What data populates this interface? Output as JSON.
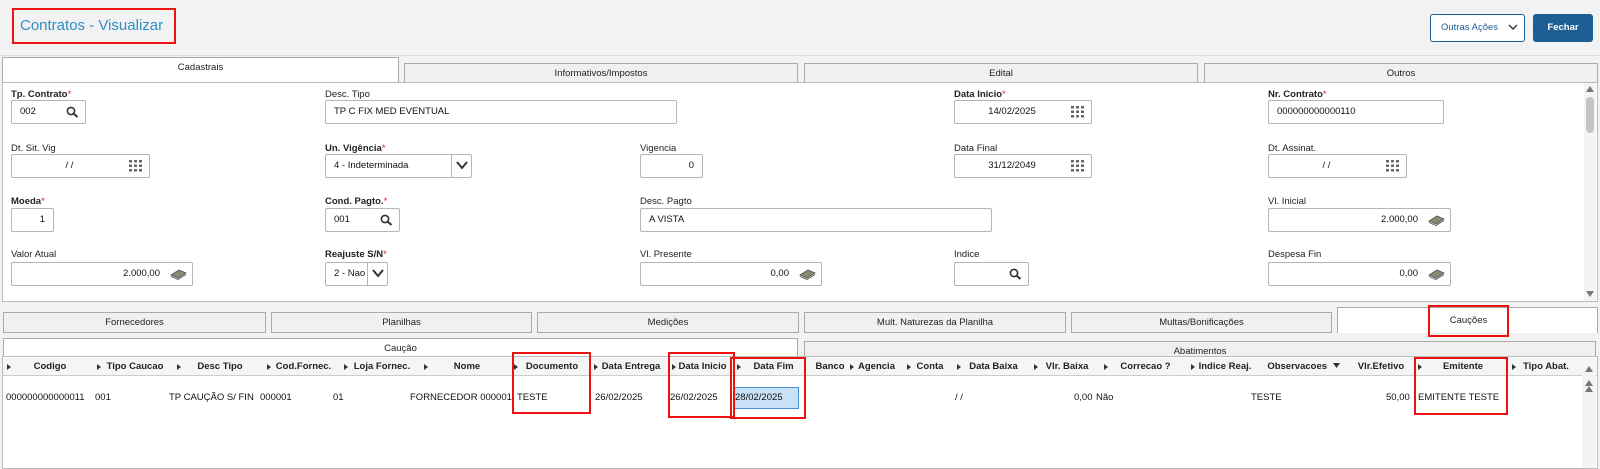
{
  "header": {
    "title": "Contratos - Visualizar",
    "actions_label": "Outras Ações",
    "close_label": "Fechar"
  },
  "top_tabs": [
    "Cadastrais",
    "Informativos/Impostos",
    "Edital",
    "Outros"
  ],
  "form": {
    "tp_contrato": {
      "label": "Tp. Contrato",
      "value": "002"
    },
    "desc_tipo": {
      "label": "Desc. Tipo",
      "value": "TP C FIX MED EVENTUAL"
    },
    "data_inicio": {
      "label": "Data Inicio",
      "value": "14/02/2025"
    },
    "nr_contrato": {
      "label": "Nr. Contrato",
      "value": "000000000000110"
    },
    "dt_sit_vig": {
      "label": "Dt. Sit. Vig",
      "value": " /  /"
    },
    "un_vigencia": {
      "label": "Un. Vigência",
      "value": "4 - Indeterminada"
    },
    "vigencia": {
      "label": "Vigencia",
      "value": "0"
    },
    "data_final": {
      "label": "Data Final",
      "value": "31/12/2049"
    },
    "dt_assinat": {
      "label": "Dt. Assinat.",
      "value": " /  /"
    },
    "moeda": {
      "label": "Moeda",
      "value": "1"
    },
    "cond_pagto": {
      "label": "Cond. Pagto.",
      "value": "001"
    },
    "desc_pagto": {
      "label": "Desc. Pagto",
      "value": "A VISTA"
    },
    "vl_inicial": {
      "label": "Vl. Inicial",
      "value": "2.000,00"
    },
    "valor_atual": {
      "label": "Valor Atual",
      "value": "2.000,00"
    },
    "reajuste": {
      "label": "Reajuste S/N",
      "value": "2 - Nao"
    },
    "vl_presente": {
      "label": "Vl. Presente",
      "value": "0,00"
    },
    "indice": {
      "label": "Indice",
      "value": ""
    },
    "despesa_fin": {
      "label": "Despesa Fin",
      "value": "0,00"
    }
  },
  "bottom_tabs": [
    "Fornecedores",
    "Planilhas",
    "Medições",
    "Mult. Naturezas da Planilha",
    "Multas/Bonificações",
    "Cauções"
  ],
  "sub_tabs": [
    "Caução",
    "Abatimentos"
  ],
  "grid": {
    "columns": [
      "Codigo",
      "Tipo Caucao",
      "Desc Tipo",
      "Cod.Fornec.",
      "Loja Fornec.",
      "Nome",
      "Documento",
      "Data Entrega",
      "Data Inicio",
      "Data Fim",
      "Banco",
      "Agencia",
      "Conta",
      "Data Baixa",
      "Vlr. Baixa",
      "Correcao ?",
      "Indice Reaj.",
      "Observacoes",
      "Vlr.Efetivo",
      "Emitente",
      "Tipo Abat."
    ],
    "row": {
      "codigo": "000000000000011",
      "tipo_caucao": "001",
      "desc_tipo": "TP CAUÇÃO S/ FIN",
      "cod_fornec": "000001",
      "loja_fornec": "01",
      "nome": "FORNECEDOR 000001",
      "documento": "TESTE",
      "data_entrega": "26/02/2025",
      "data_inicio": "26/02/2025",
      "data_fim": "28/02/2025",
      "data_baixa": " /  /",
      "vlr_baixa": "0,00",
      "correcao": "Não",
      "observacoes": "TESTE",
      "vlr_efetivo": "50,00",
      "emitente": "EMITENTE TESTE"
    }
  },
  "colors": {
    "accent": "#1d5e95",
    "title": "#2e8fc5",
    "highlight": "#ee1111",
    "required": "#e02020"
  }
}
